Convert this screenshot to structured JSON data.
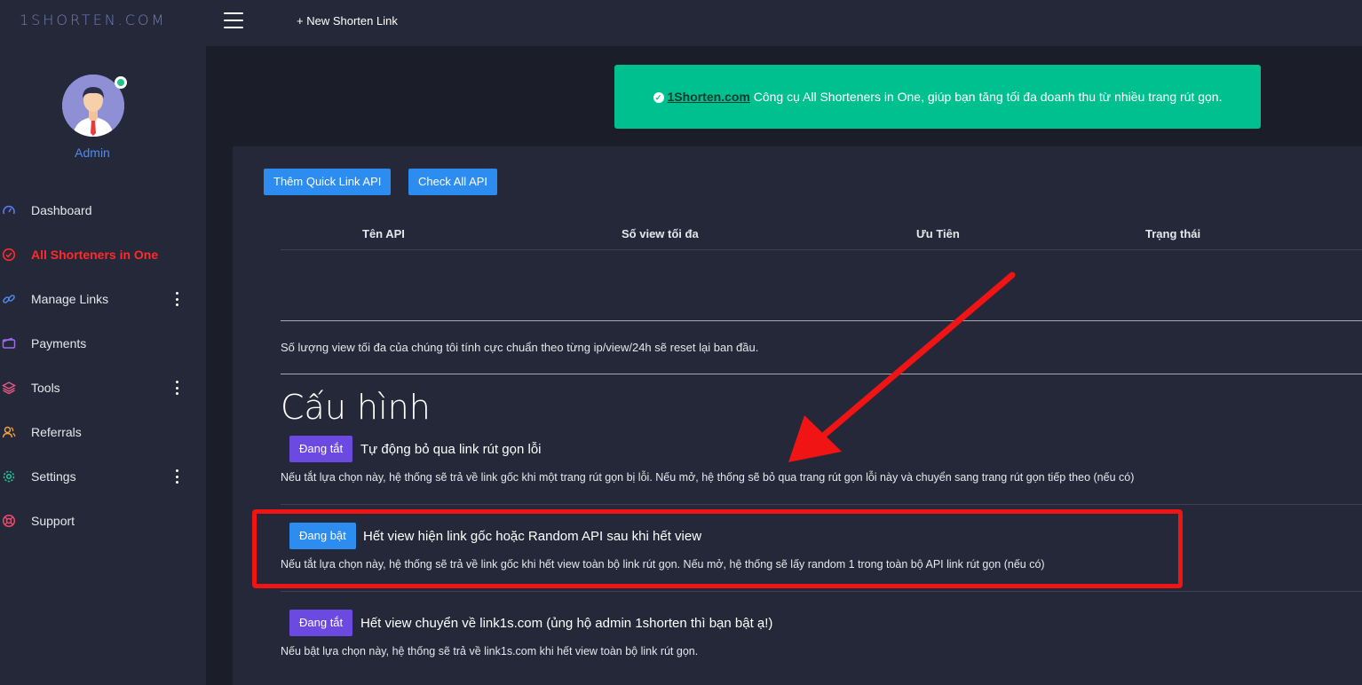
{
  "topbar": {
    "brand": "1SHORTEN.COM",
    "new_link": "+ New Shorten Link"
  },
  "sidebar": {
    "user_name": "Admin",
    "items": [
      {
        "label": "Dashboard",
        "icon": "gauge-icon"
      },
      {
        "label": "All Shorteners in One",
        "icon": "check-circle-icon",
        "active": true
      },
      {
        "label": "Manage Links",
        "icon": "link-icon"
      },
      {
        "label": "Payments",
        "icon": "wallet-icon"
      },
      {
        "label": "Tools",
        "icon": "layers-icon"
      },
      {
        "label": "Referrals",
        "icon": "users-icon"
      },
      {
        "label": "Settings",
        "icon": "gear-icon"
      },
      {
        "label": "Support",
        "icon": "lifebuoy-icon"
      }
    ]
  },
  "notice": {
    "site": "1Shorten.com",
    "text": " Công cụ All Shorteners in One, giúp bạn tăng tối đa doanh thu từ nhiều trang rút gọn."
  },
  "panel": {
    "btn_add": "Thêm Quick Link API",
    "btn_check": "Check All API",
    "table_headers": [
      "Tên API",
      "Số view tối đa",
      "Ưu Tiên",
      "Trạng thái"
    ],
    "note": "Số lượng view tối đa của chúng tôi tính cực chuẩn theo từng ip/view/24h sẽ reset lại ban đầu."
  },
  "config": {
    "title": "Cấu hình",
    "options": [
      {
        "state": "Đang tắt",
        "title": "Tự động bỏ qua link rút gọn lỗi",
        "desc": "Nếu tắt lựa chọn này, hệ thống sẽ trả về link gốc khi một trang rút gọn bị lỗi. Nếu mở, hệ thống sẽ bỏ qua trang rút gọn lỗi này và chuyển sang trang rút gọn tiếp theo (nếu có)"
      },
      {
        "state": "Đang bật",
        "title": "Hết view hiện link gốc hoặc Random API sau khi hết view",
        "desc": "Nếu tắt lựa chọn này, hệ thống sẽ trả về link gốc khi hết view toàn bộ link rút gọn. Nếu mở, hệ thống sẽ lấy random 1 trong toàn bộ API link rút gọn (nếu có)"
      },
      {
        "state": "Đang tắt",
        "title": "Hết view chuyển về link1s.com (ủng hộ admin 1shorten thì bạn bật ạ!)",
        "desc": "Nếu bật lựa chọn này, hệ thống sẽ trả về link1s.com khi hết view toàn bộ link rút gọn."
      }
    ]
  },
  "colors": {
    "accent": "#2d8cf0",
    "active_nav": "#ff2b2b",
    "notice": "#00c08f",
    "toggle_off": "#6c49e0",
    "highlight": "#f01414"
  }
}
